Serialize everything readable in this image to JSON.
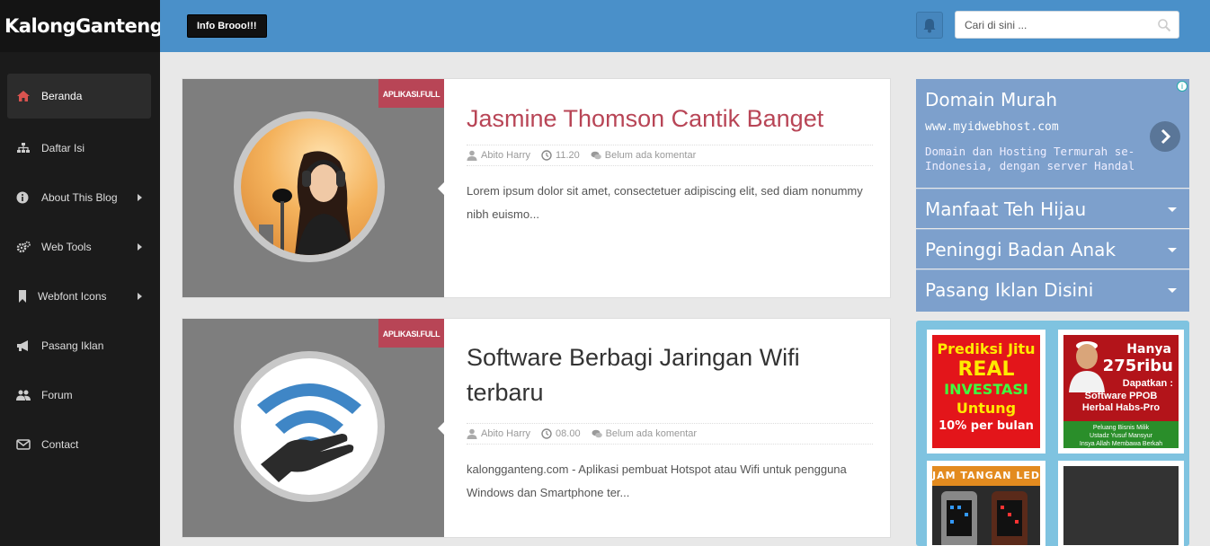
{
  "brand": {
    "logo_text": "KalongGanteng"
  },
  "header": {
    "info_button": "Info Brooo!!!",
    "search_placeholder": "Cari di sini ..."
  },
  "sidebar": {
    "items": [
      {
        "label": "Beranda",
        "icon": "home-icon",
        "active": true,
        "has_submenu": false
      },
      {
        "label": "Daftar Isi",
        "icon": "sitemap-icon",
        "has_submenu": false
      },
      {
        "label": "About This Blog",
        "icon": "info-icon",
        "has_submenu": true
      },
      {
        "label": "Web Tools",
        "icon": "gears-icon",
        "has_submenu": true
      },
      {
        "label": "Webfont Icons",
        "icon": "bookmark-icon",
        "has_submenu": true
      },
      {
        "label": "Pasang Iklan",
        "icon": "bullhorn-icon",
        "has_submenu": false
      },
      {
        "label": "Forum",
        "icon": "users-icon",
        "has_submenu": false
      },
      {
        "label": "Contact",
        "icon": "envelope-icon",
        "has_submenu": false
      }
    ]
  },
  "posts": [
    {
      "badge": "APLIKASI.FULL",
      "title": "Jasmine Thomson Cantik Banget",
      "author": "Abito Harry",
      "time": "11.20",
      "comments": "Belum ada komentar",
      "excerpt": "Lorem ipsum dolor sit amet, consectetuer adipiscing elit,  sed diam nonummy nibh euismo...",
      "title_color": "#b84556"
    },
    {
      "badge": "APLIKASI.FULL",
      "title": "Software Berbagi Jaringan Wifi terbaru",
      "author": "Abito Harry",
      "time": "08.00",
      "comments": "Belum ada komentar",
      "excerpt": "kalongganteng.com -  Aplikasi pembuat Hotspot atau Wifi untuk pengguna Windows dan Smartphone ter...",
      "title_color": "#333333"
    }
  ],
  "ad": {
    "title": "Domain Murah",
    "url": "www.myidwebhost.com",
    "description": "Domain dan Hosting Termurah se-Indonesia, dengan server Handal",
    "info_mark": "i"
  },
  "accordion": [
    {
      "label": "Manfaat Teh Hijau"
    },
    {
      "label": "Peninggi Badan Anak"
    },
    {
      "label": "Pasang Iklan Disini"
    }
  ],
  "banners": {
    "b1": {
      "l1": "Prediksi Jitu",
      "l2": "REAL",
      "l3": "INVESTASI",
      "l4": "Untung",
      "l5": "10% per bulan"
    },
    "b2": {
      "p1": "Hanya",
      "p2": "275ribu",
      "p3": "Dapatkan :",
      "p4a": "Software PPOB",
      "p4b": "Herbal Habs-Pro",
      "p5a": "Peluang Bisnis Milik",
      "p5b": "Ustadz Yusuf Mansyur",
      "p5c": "Insya Allah Membawa Berkah"
    },
    "b3": {
      "title": "JAM TANGAN LED"
    }
  },
  "colors": {
    "sidebar_bg": "#1b1b1b",
    "header_bg": "#4a90c9",
    "accent_red": "#b84556",
    "widget_blue": "#7da0cc",
    "banner_area": "#7fc3e0"
  }
}
